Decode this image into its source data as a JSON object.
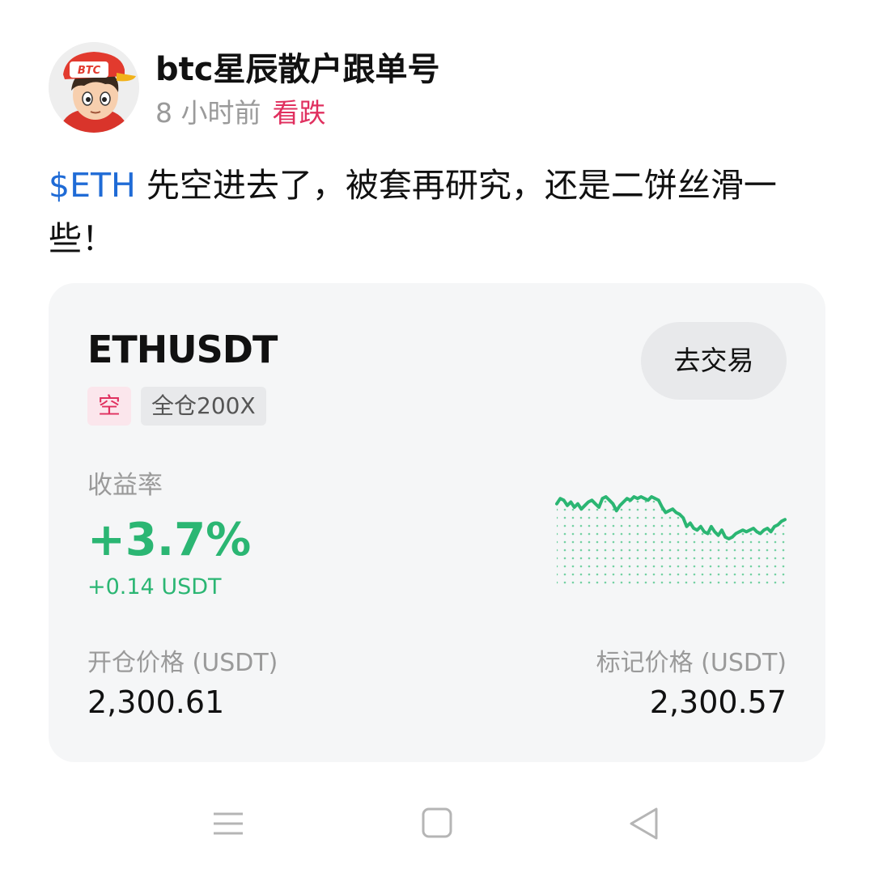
{
  "author": {
    "name": "btc星辰散户跟单号",
    "avatar_icon": "cartoon-avatar-btc-cap",
    "avatar_cap_text": "BTC"
  },
  "meta": {
    "time": "8 小时前",
    "sentiment": "看跌",
    "sentiment_color": "#e0305f"
  },
  "post": {
    "ticker": "$ETH",
    "ticker_color": "#1f6bd6",
    "text": " 先空进去了，被套再研究，还是二饼丝滑一些！"
  },
  "card": {
    "symbol": "ETHUSDT",
    "trade_button": "去交易",
    "side_badge": "空",
    "leverage_badge": "全仓200X",
    "yield_label": "收益率",
    "yield_value": "+3.7%",
    "yield_amount": "+0.14 USDT",
    "profit_color": "#2bb673",
    "open_price_label": "开仓价格 (USDT)",
    "open_price": "2,300.61",
    "mark_price_label": "标记价格 (USDT)",
    "mark_price": "2,300.57",
    "sparkline": [
      60,
      63,
      62,
      59,
      61,
      58,
      60,
      57,
      59,
      61,
      62,
      60,
      58,
      63,
      64,
      62,
      60,
      56,
      59,
      61,
      63,
      62,
      64,
      63,
      64,
      63,
      62,
      64,
      63,
      62,
      58,
      55,
      56,
      57,
      55,
      54,
      52,
      47,
      49,
      46,
      45,
      47,
      44,
      43,
      47,
      44,
      42,
      45,
      41,
      40,
      41,
      43,
      44,
      45,
      44,
      45,
      46,
      44,
      43,
      45,
      46,
      44,
      47,
      48,
      50,
      51
    ]
  },
  "navbar": {
    "menu_icon": "menu-icon",
    "home_icon": "home-square-icon",
    "back_icon": "back-triangle-icon"
  }
}
